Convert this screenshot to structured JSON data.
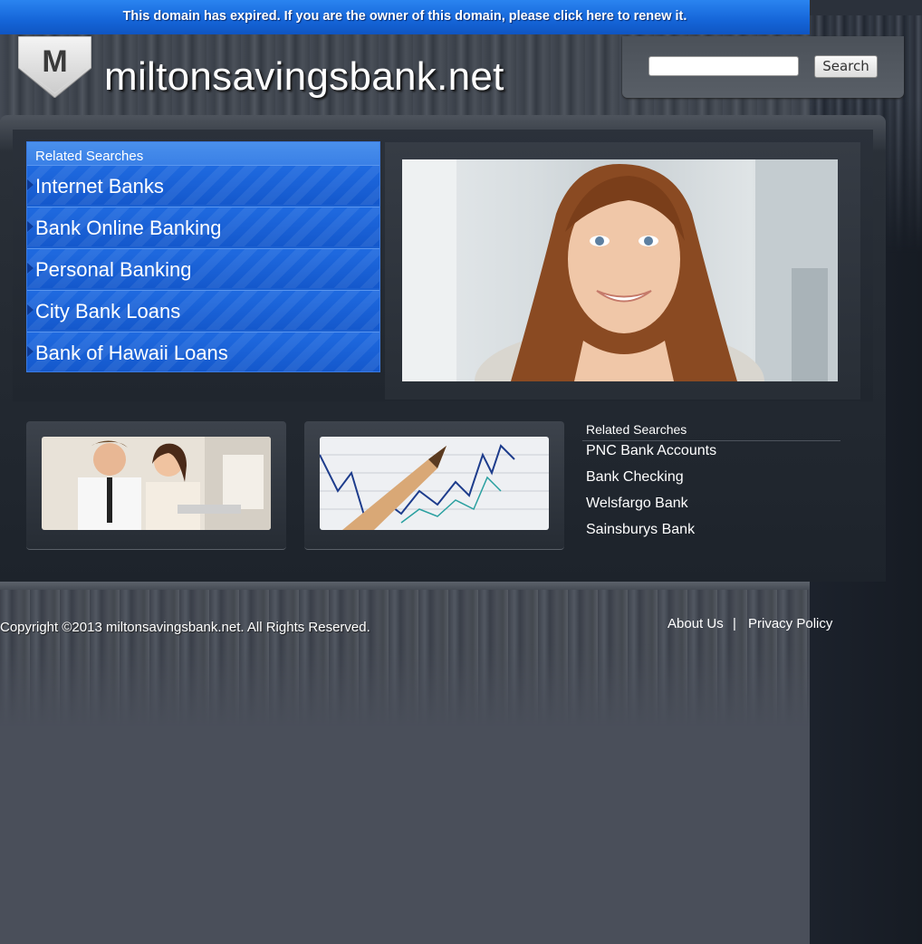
{
  "banner": {
    "expired_text": "This domain has expired. If you are the owner of this domain, please click here to renew it."
  },
  "header": {
    "logo_letter": "M",
    "site_title": "miltonsavingsbank.net",
    "search_placeholder": "",
    "search_button": "Search"
  },
  "related": {
    "title": "Related Searches",
    "items": [
      {
        "label": "Internet Banks"
      },
      {
        "label": "Bank Online Banking"
      },
      {
        "label": "Personal Banking"
      },
      {
        "label": "City Bank Loans"
      },
      {
        "label": "Bank of Hawaii Loans"
      }
    ]
  },
  "side_related": {
    "title": "Related Searches",
    "items": [
      {
        "label": "PNC Bank Accounts"
      },
      {
        "label": "Bank Checking"
      },
      {
        "label": "Welsfargo Bank"
      },
      {
        "label": "Sainsburys Bank"
      }
    ]
  },
  "footer": {
    "copyright": "Copyright ©2013 miltonsavingsbank.net. All Rights Reserved.",
    "about": "About Us",
    "separator": "|",
    "privacy": "Privacy Policy"
  },
  "colors": {
    "banner_blue": "#1565d8",
    "related_blue": "#1a5fd0",
    "background_dark": "#1b212c",
    "footer_gray": "#4a4f5a"
  },
  "icons": {
    "logo": "shield-m-icon",
    "list_bullet": "triangle-right-icon"
  }
}
